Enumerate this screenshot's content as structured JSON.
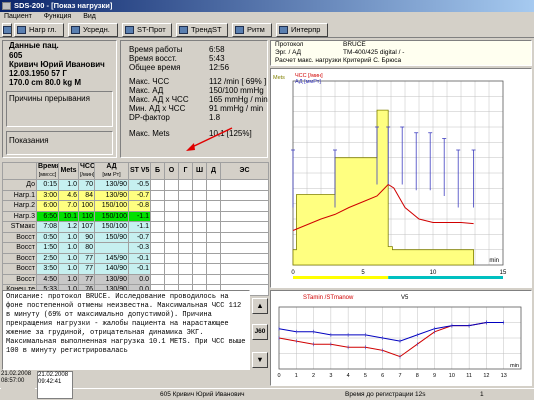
{
  "window": {
    "title": "SDS-200 - [Показ нагрузки]"
  },
  "menu": [
    "Пациент",
    "Функция",
    "Вид"
  ],
  "toolbar": [
    "Нагр гл.",
    "Усредн.",
    "ST-Прот",
    "ТрендST",
    "Ритм",
    "Интерпр"
  ],
  "patient": {
    "header": "Данные пац.",
    "id": "605",
    "name": "Кривич Юрий Иванович",
    "dob_age": "12.03.1950  57 Г",
    "height_weight": "170.0 cm   80.0 kg  M",
    "reasons_title": "Причины прерывания",
    "indications_title": "Показания"
  },
  "summary": {
    "times": [
      {
        "label": "Время работы",
        "value": "6:58"
      },
      {
        "label": "Время восст.",
        "value": "5:43"
      },
      {
        "label": "Общее время",
        "value": "12:56"
      }
    ],
    "stats": [
      {
        "label": "Макс. ЧСС",
        "value": "112 /min  [ 69% ]"
      },
      {
        "label": "Макс. АД",
        "value": "150/100 mmHg"
      },
      {
        "label": "Макс. АД x ЧСС",
        "value": "165 mmHg / min"
      },
      {
        "label": "Мин. АД x ЧСС",
        "value": "91 mmHg / min"
      },
      {
        "label": "DP-фактор",
        "value": "1.8"
      }
    ],
    "mets": {
      "label": "Макс. Mets",
      "value": "10,1  [125%]"
    }
  },
  "protocol": {
    "rows": [
      {
        "label": "Протокол",
        "value": "BRUCE"
      },
      {
        "label": "Эрг. / АД",
        "value": "TM-400/425 digital / -"
      },
      {
        "label": "Расчет макс. нагрузки",
        "value": "Критерий С. Брюса"
      }
    ]
  },
  "table": {
    "headers": [
      "",
      "Время Нагрузк",
      "Mets",
      "ЧСС",
      "АД",
      "ST V5",
      "Б",
      "О",
      "Г",
      "Ш",
      "Д",
      "ЭС"
    ],
    "subheaders": [
      "",
      "[мм:сс]",
      "",
      "[/мин]",
      "[мм Рт]",
      "",
      "",
      "",
      "",
      "",
      "",
      ""
    ],
    "rows": [
      {
        "label": "До",
        "time": "0:15",
        "load": "1.0",
        "mets": "70",
        "hr": "130/90",
        "st": "-0.5",
        "cls": "row-cyan"
      },
      {
        "label": "Нагр.1",
        "time": "3:00",
        "load": "4.6",
        "mets": "84",
        "hr": "130/90",
        "st": "-0.7",
        "cls": "row-yellow"
      },
      {
        "label": "Нагр.2",
        "time": "6:00",
        "load": "7.0",
        "mets": "100",
        "hr": "150/100",
        "st": "-0.8",
        "cls": "row-yellow"
      },
      {
        "label": "Нагр.3",
        "time": "6:50",
        "load": "10.1",
        "mets": "110",
        "hr": "150/100",
        "st": "-1.1",
        "cls": "row-green"
      },
      {
        "label": "STмакс",
        "time": "7:08",
        "load": "1.2",
        "mets": "107",
        "hr": "150/100",
        "st": "-1.1",
        "cls": "row-cyan"
      },
      {
        "label": "Восст",
        "time": "0:50",
        "load": "1.0",
        "mets": "90",
        "hr": "150/90",
        "st": "-0.7",
        "cls": "row-cyan"
      },
      {
        "label": "Восст",
        "time": "1:50",
        "load": "1.0",
        "mets": "80",
        "hr": "",
        "st": "-0.3",
        "cls": "row-cyan"
      },
      {
        "label": "Восст",
        "time": "2:50",
        "load": "1.0",
        "mets": "77",
        "hr": "145/90",
        "st": "-0.1",
        "cls": "row-cyan"
      },
      {
        "label": "Восст",
        "time": "3:50",
        "load": "1.0",
        "mets": "77",
        "hr": "140/90",
        "st": "-0.1",
        "cls": "row-cyan"
      },
      {
        "label": "Восст",
        "time": "4:50",
        "load": "1.0",
        "mets": "77",
        "hr": "130/90",
        "st": "0.0",
        "cls": "row-grey"
      },
      {
        "label": "Конец те",
        "time": "5:33",
        "load": "1.0",
        "mets": "76",
        "hr": "130/90",
        "st": "0.0",
        "cls": "row-grey"
      }
    ]
  },
  "report_text": "Описание: протокол BRUCE. Исследование проводилось на фоне постепенной отмены неизвестна. Максимальная ЧСС 112 в минуту (69% от максимально допустимой). Причина прекращения нагрузки - жалобы пациента на нарастающее жжение за грудиной, отрицательная динамика ЭКГ. Максимальная выполненная нагрузка 10.1 METS. При ЧСС выше 100 в минуту регистрировалась",
  "main_chart_legend": {
    "mets": "Mets",
    "hr": "ЧСС [/мин]",
    "bp": "АД [ммРт]"
  },
  "st_chart": {
    "legend": "STamin /STmanow",
    "lead": "V5"
  },
  "side_buttons": {
    "up": "▲",
    "j60": "J60",
    "down": "▼"
  },
  "chart_data": [
    {
      "type": "line",
      "title": "",
      "xlabel": "min",
      "x_ticks": [
        0,
        5,
        10,
        15
      ],
      "xlim": [
        0,
        15
      ],
      "series": [
        {
          "name": "Mets",
          "x": [
            0,
            0.25,
            0.25,
            3,
            3,
            6,
            6,
            6.8,
            6.8,
            7.1,
            7.1,
            12.9
          ],
          "values": [
            1.0,
            1.0,
            4.6,
            4.6,
            7.0,
            7.0,
            10.1,
            10.1,
            1.2,
            1.2,
            1.0,
            1.0
          ]
        },
        {
          "name": "ЧСС [/мин]",
          "x": [
            0,
            1,
            2,
            3,
            4,
            5,
            6,
            6.8,
            7.2,
            8,
            9,
            10,
            11,
            12,
            12.9
          ],
          "values": [
            70,
            75,
            80,
            84,
            90,
            95,
            100,
            110,
            107,
            90,
            80,
            77,
            77,
            77,
            76
          ]
        },
        {
          "name": "АД [ммРт]",
          "x": [
            0,
            3,
            6,
            6.8,
            7.8,
            8.8,
            9.8,
            10.8,
            11.8,
            12.9
          ],
          "values": [
            130,
            130,
            150,
            150,
            150,
            145,
            145,
            140,
            130,
            130
          ]
        }
      ]
    },
    {
      "type": "line",
      "title": "",
      "xlabel": "min",
      "x_ticks": [
        0,
        1,
        2,
        3,
        4,
        5,
        6,
        7,
        8,
        9,
        10,
        11,
        12,
        13
      ],
      "xlim": [
        0,
        14
      ],
      "series": [
        {
          "name": "STamin",
          "x": [
            0,
            1,
            2,
            3,
            4,
            5,
            6,
            7,
            8,
            9,
            10,
            11,
            12,
            13
          ],
          "values": [
            -0.5,
            -0.6,
            -0.7,
            -0.7,
            -0.8,
            -0.8,
            -0.9,
            -1.1,
            -0.7,
            -0.3,
            -0.1,
            -0.1,
            0.0,
            0.0
          ]
        },
        {
          "name": "STmanow",
          "x": [
            0,
            1,
            2,
            3,
            4,
            5,
            6,
            7,
            8,
            9,
            10,
            11,
            12,
            13
          ],
          "values": [
            -0.2,
            -0.3,
            -0.3,
            -0.4,
            -0.4,
            -0.4,
            -0.5,
            -0.6,
            -0.4,
            -0.2,
            -0.1,
            -0.1,
            0.0,
            0.0
          ]
        }
      ]
    }
  ],
  "status": {
    "left1": "21.02.2008\n08:57:00",
    "left2": "21.02.2008\n09:42:41",
    "patient": "605  Кривич Юрий Иванович",
    "reg": "Время до регистрации 12s",
    "num": "1"
  }
}
